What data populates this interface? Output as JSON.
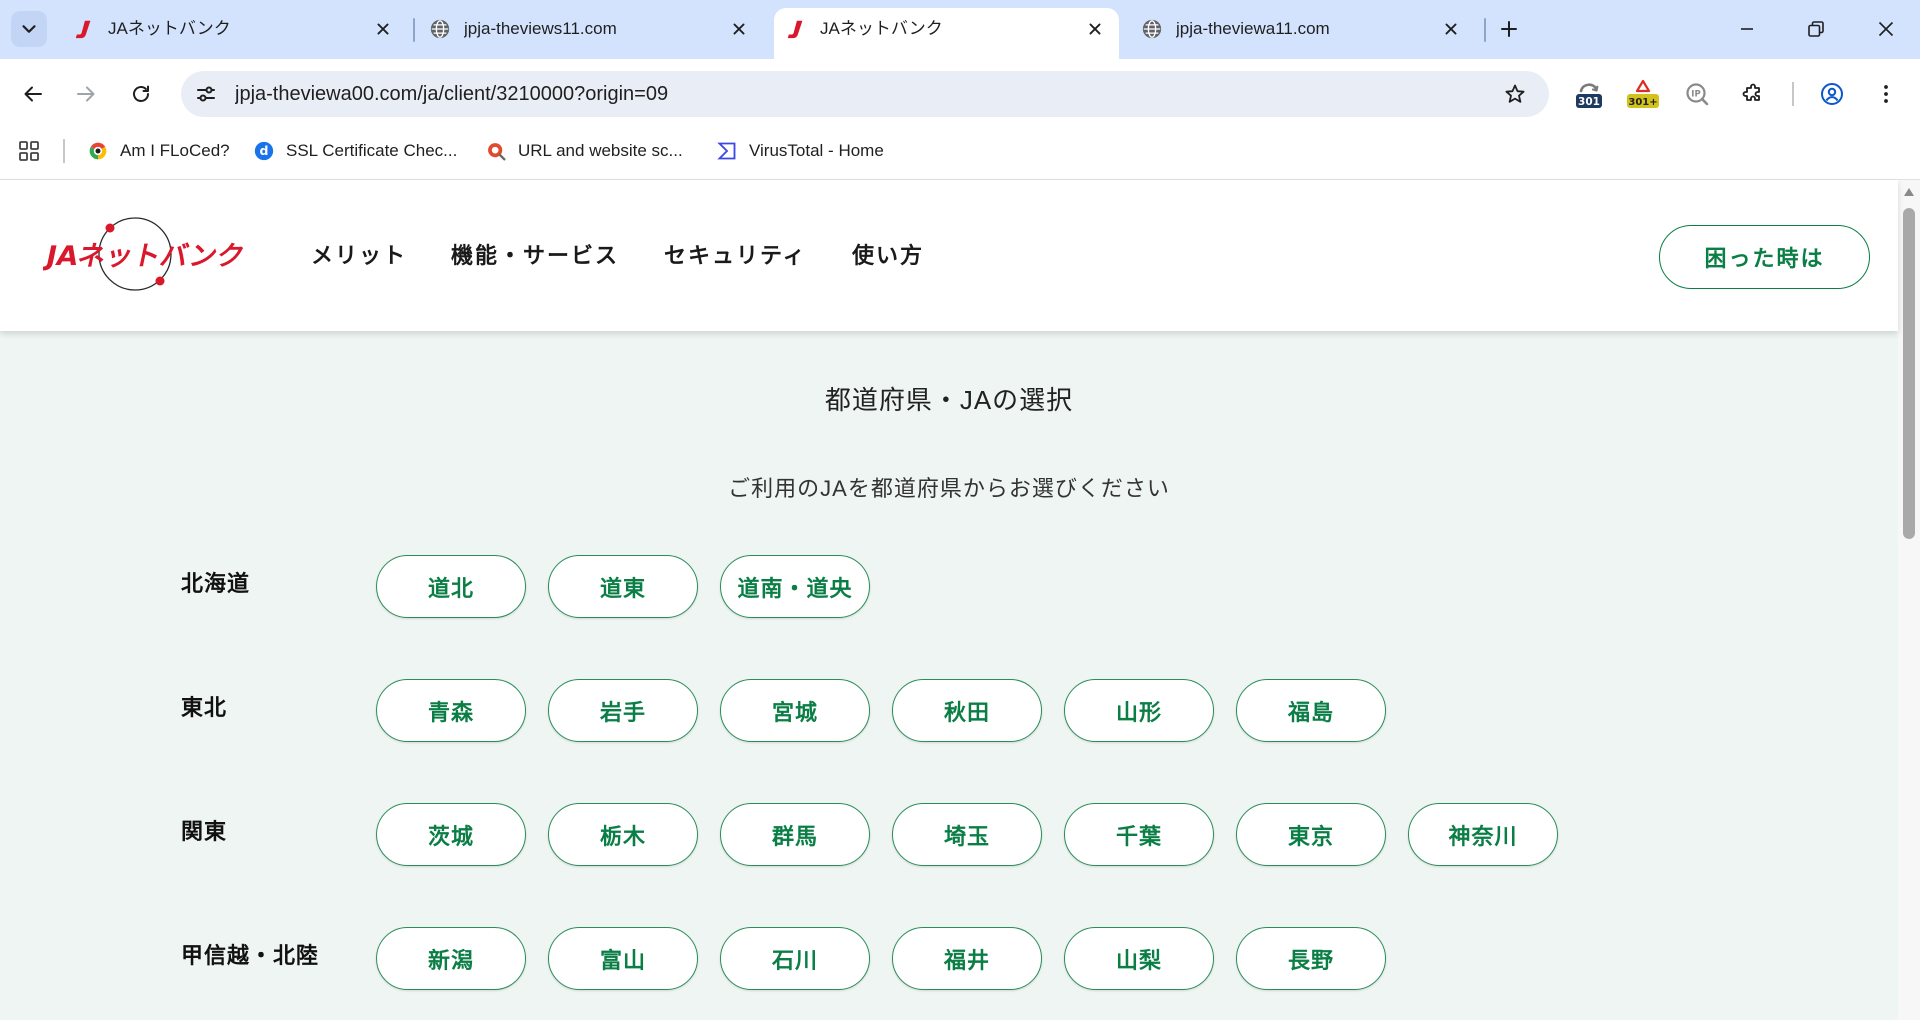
{
  "browser": {
    "tabs": [
      {
        "title": "JAネットバンク",
        "icon": "ja-bank-favicon",
        "active": false
      },
      {
        "title": "jpja-theviews11.com",
        "icon": "globe-icon",
        "active": false
      },
      {
        "title": "JAネットバンク",
        "icon": "ja-bank-favicon",
        "active": true
      },
      {
        "title": "jpja-theviewa11.com",
        "icon": "globe-icon",
        "active": false
      }
    ],
    "omnibox": {
      "url": "jpja-theviewa00.com/ja/client/3210000?origin=09"
    },
    "extensions": [
      {
        "icon": "redirect-path-icon",
        "badge": "301"
      },
      {
        "icon": "redirect-warning-icon",
        "badge": "301+"
      },
      {
        "icon": "ip-lookup-icon",
        "label": "IP"
      },
      {
        "icon": "puzzle-icon"
      }
    ],
    "bookmarks": [
      {
        "title": "Am I FLoCed?",
        "icon": "floc-eye-icon"
      },
      {
        "title": "SSL Certificate Chec...",
        "icon": "ssl-checker-icon",
        "icon_letter": "d"
      },
      {
        "title": "URL and website sc...",
        "icon": "urlscan-icon"
      },
      {
        "title": "VirusTotal - Home",
        "icon": "virustotal-icon"
      }
    ]
  },
  "site": {
    "logo_text": "JAネットバンク",
    "nav": [
      "メリット",
      "機能・サービス",
      "セキュリティ",
      "使い方"
    ],
    "help_button": "困った時は"
  },
  "main": {
    "title": "都道府県・JAの選択",
    "subtitle": "ご利用のJAを都道府県からお選びください",
    "regions": [
      {
        "name": "北海道",
        "prefectures": [
          "道北",
          "道東",
          "道南・道央"
        ]
      },
      {
        "name": "東北",
        "prefectures": [
          "青森",
          "岩手",
          "宮城",
          "秋田",
          "山形",
          "福島"
        ]
      },
      {
        "name": "関東",
        "prefectures": [
          "茨城",
          "栃木",
          "群馬",
          "埼玉",
          "千葉",
          "東京",
          "神奈川"
        ]
      },
      {
        "name": "甲信越・北陸",
        "prefectures": [
          "新潟",
          "富山",
          "石川",
          "福井",
          "山梨",
          "長野"
        ]
      }
    ]
  },
  "colors": {
    "brand_green": "#0b7e46",
    "brand_red": "#d9182b",
    "page_background": "#eef5f2",
    "tab_strip": "#d3e3fd",
    "omnibox": "#e9eef6"
  }
}
